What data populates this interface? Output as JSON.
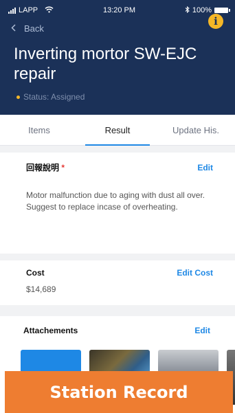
{
  "status_bar": {
    "carrier": "LAPP",
    "time": "13:20 PM",
    "battery": "100%"
  },
  "nav": {
    "back_label": "Back"
  },
  "header": {
    "title": "Inverting mortor SW-EJC repair",
    "status": "Status: Assigned"
  },
  "tabs": [
    {
      "label": "Items"
    },
    {
      "label": "Result",
      "active": true
    },
    {
      "label": "Update His."
    }
  ],
  "report": {
    "title": "回報說明",
    "required_mark": "*",
    "edit_label": "Edit",
    "description": "Motor malfunction due to aging with dust all over.  Suggest to replace incase of overheating."
  },
  "cost": {
    "title": "Cost",
    "edit_label": "Edit Cost",
    "value": "$14,689"
  },
  "attachments": {
    "title": "Attachements",
    "edit_label": "Edit"
  },
  "banner": {
    "label": "Station Record"
  },
  "colors": {
    "header_bg": "#1b3158",
    "accent": "#1e88e5",
    "warning": "#f5b727",
    "banner": "#ee7d31"
  }
}
